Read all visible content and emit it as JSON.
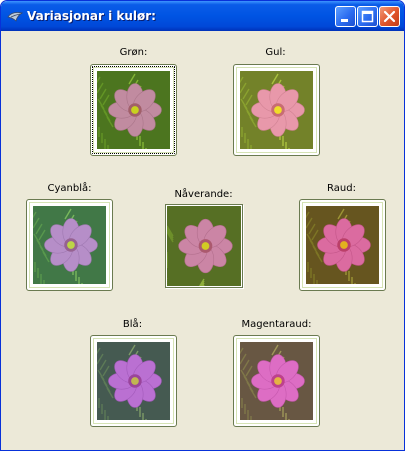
{
  "window": {
    "title": "Variasjonar i kulør:",
    "buttons": {
      "minimize_icon": "minimize-icon",
      "maximize_icon": "maximize-icon",
      "close_icon": "close-icon"
    }
  },
  "variants": {
    "green": {
      "label": "Grøn:",
      "tint": "#6FAF2A"
    },
    "yellow": {
      "label": "Gul:",
      "tint": "#E8D84A"
    },
    "cyan": {
      "label": "Cyanblå:",
      "tint": "#4FB7A8"
    },
    "current": {
      "label": "Nåverande:",
      "tint": "#8E9A3A"
    },
    "red": {
      "label": "Raud:",
      "tint": "#C04A2A"
    },
    "blue": {
      "label": "Blå:",
      "tint": "#5A5AC8"
    },
    "magenta": {
      "label": "Magentaraud:",
      "tint": "#C8509A"
    }
  },
  "colors": {
    "titlebar": "#0054E3",
    "window_bg": "#ECE9D8",
    "flower": "#E87BD8",
    "center": "#F2E21A"
  }
}
